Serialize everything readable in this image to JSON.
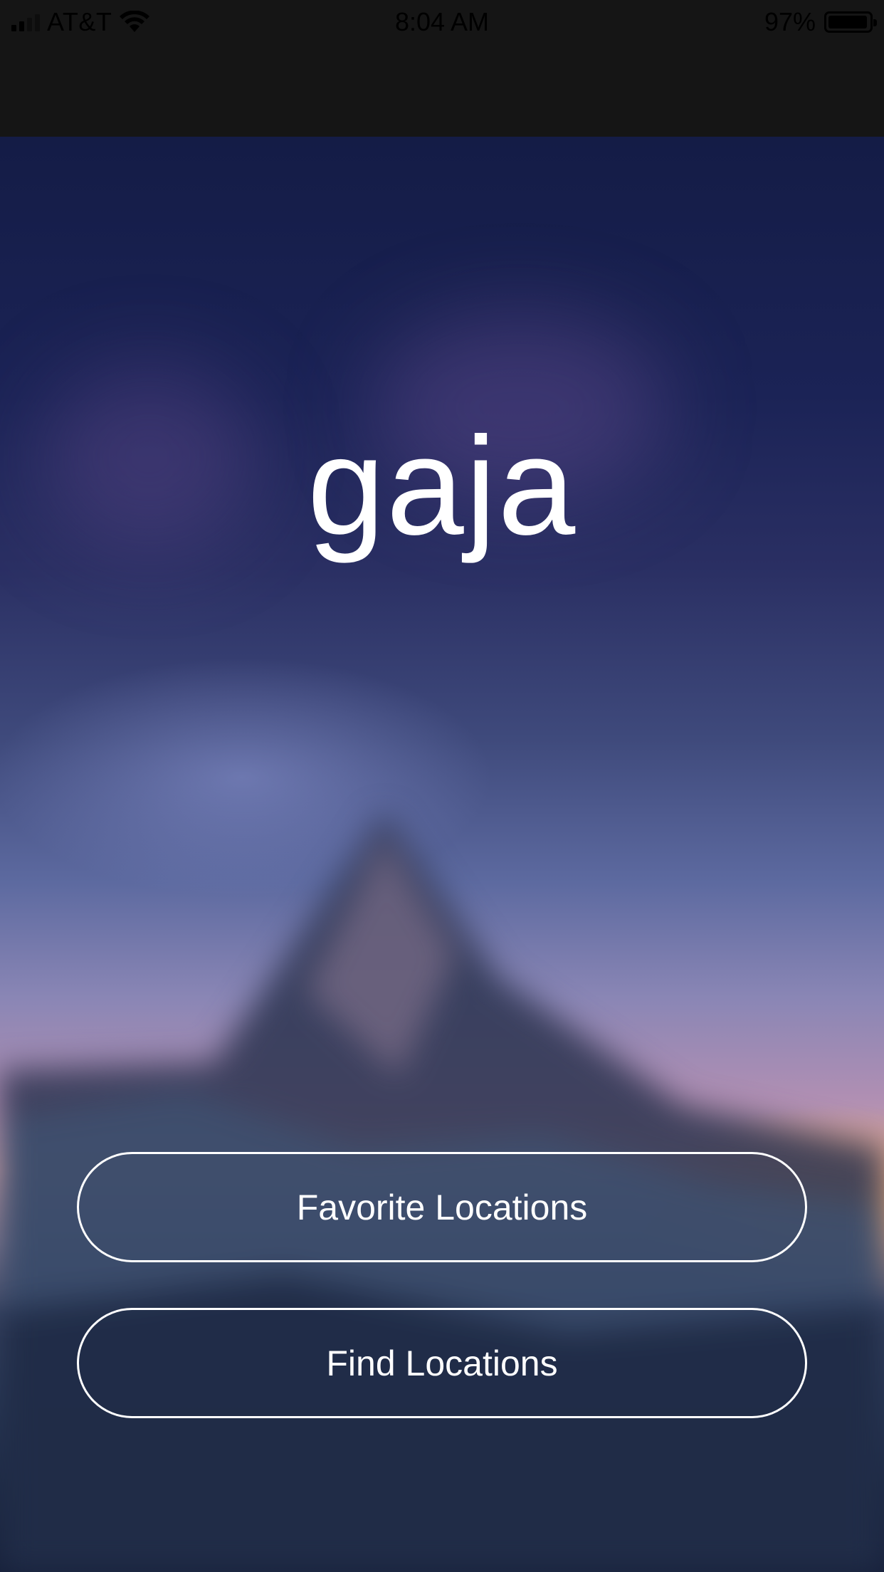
{
  "status_bar": {
    "carrier": "AT&T",
    "time": "8:04 AM",
    "battery_percent_label": "97%",
    "battery_level": 0.97,
    "signal_icon": "cellular-signal-icon",
    "wifi_icon": "wifi-icon",
    "battery_icon": "battery-icon"
  },
  "app": {
    "title": "gaja"
  },
  "buttons": {
    "favorite_locations": "Favorite Locations",
    "find_locations": "Find Locations"
  },
  "colors": {
    "top_band": "#151515",
    "button_border": "#ffffff",
    "text": "#ffffff",
    "sunset_accent": "#eea864"
  }
}
